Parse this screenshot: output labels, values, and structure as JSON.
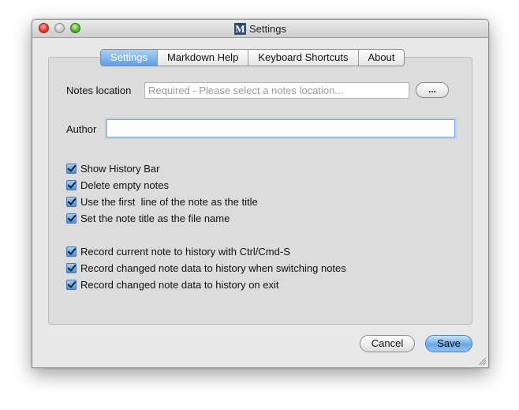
{
  "window": {
    "title": "Settings",
    "app_icon_letter": "M",
    "controls": [
      "close-icon",
      "minimize-icon",
      "zoom-icon"
    ]
  },
  "tabs": [
    {
      "label": "Settings",
      "active": true
    },
    {
      "label": "Markdown Help",
      "active": false
    },
    {
      "label": "Keyboard Shortcuts",
      "active": false
    },
    {
      "label": "About",
      "active": false
    }
  ],
  "notes_location": {
    "label": "Notes location",
    "placeholder": "Required - Please select a notes location...",
    "value": "",
    "browse_label": "..."
  },
  "author": {
    "label": "Author",
    "value": ""
  },
  "options_group1": [
    {
      "label": "Show History Bar",
      "checked": true
    },
    {
      "label": "Delete empty notes",
      "checked": true
    },
    {
      "label": "Use the first  line of the note as the title",
      "checked": true
    },
    {
      "label": "Set the note title as the file name",
      "checked": true
    }
  ],
  "options_group2": [
    {
      "label": "Record current note to history with Ctrl/Cmd-S",
      "checked": true
    },
    {
      "label": "Record changed note data to history when switching notes",
      "checked": true
    },
    {
      "label": "Record changed note data to history on exit",
      "checked": true
    }
  ],
  "buttons": {
    "cancel": "Cancel",
    "save": "Save"
  },
  "colors": {
    "accent": "#5d9fe4",
    "window_bg": "#e8e8e8",
    "close": "#e8362e",
    "zoom": "#55b82d"
  }
}
